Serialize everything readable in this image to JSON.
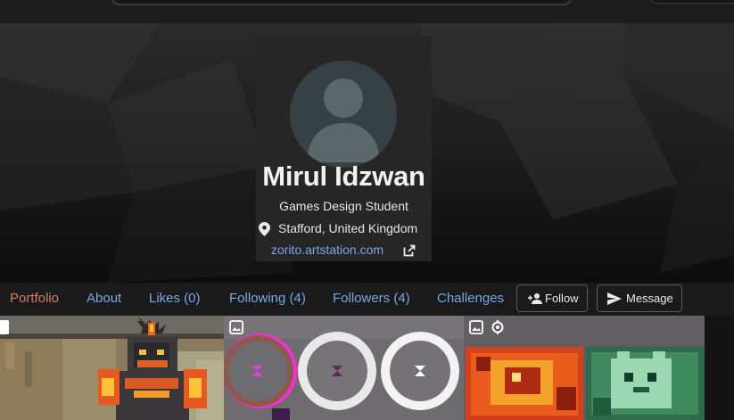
{
  "profile": {
    "name": "Mirul Idzwan",
    "headline": "Games Design Student",
    "location": "Stafford, United Kingdom",
    "website": "zorito.artstation.com"
  },
  "tabs": [
    {
      "label": "Portfolio",
      "active": true
    },
    {
      "label": "About",
      "active": false
    },
    {
      "label": "Likes (0)",
      "active": false
    },
    {
      "label": "Following (4)",
      "active": false
    },
    {
      "label": "Followers (4)",
      "active": false
    },
    {
      "label": "Challenges",
      "active": false
    }
  ],
  "actions": {
    "follow_label": "Follow",
    "message_label": "Message"
  },
  "icons": {
    "location": "map-pin-icon",
    "external": "external-link-icon",
    "follow": "add-person-icon",
    "message": "send-icon",
    "gallery": "image-icon",
    "animated": "animation-icon"
  },
  "colors": {
    "accent_link": "#7aa7e6",
    "active_tab": "#d97a6a",
    "card_bg": "#262626"
  }
}
